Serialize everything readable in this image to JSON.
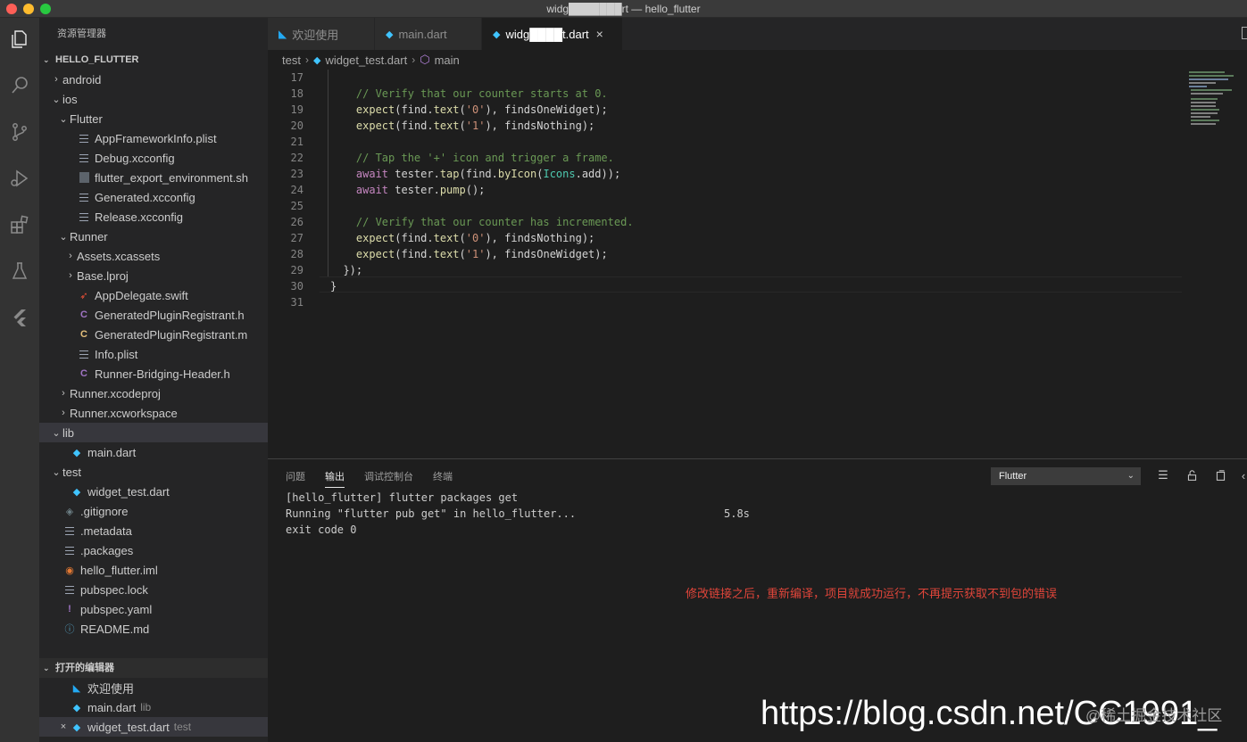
{
  "window": {
    "title": "widg███████rt — hello_flutter"
  },
  "activity_bar": {
    "items": [
      "explorer-icon",
      "search-icon",
      "source-control-icon",
      "run-debug-icon",
      "extensions-icon",
      "testing-icon",
      "flutter-icon"
    ]
  },
  "sidebar": {
    "title": "资源管理器",
    "project_section": "HELLO_FLUTTER",
    "tree": [
      {
        "label": "android",
        "indent": 1,
        "twist": "›",
        "icon": "none"
      },
      {
        "label": "ios",
        "indent": 1,
        "twist": "⌄",
        "icon": "none"
      },
      {
        "label": "Flutter",
        "indent": 2,
        "twist": "⌄",
        "icon": "none"
      },
      {
        "label": "AppFrameworkInfo.plist",
        "indent": 3,
        "twist": "",
        "icon": "lines"
      },
      {
        "label": "Debug.xcconfig",
        "indent": 3,
        "twist": "",
        "icon": "lines"
      },
      {
        "label": "flutter_export_environment.sh",
        "indent": 3,
        "twist": "",
        "icon": "sh"
      },
      {
        "label": "Generated.xcconfig",
        "indent": 3,
        "twist": "",
        "icon": "lines"
      },
      {
        "label": "Release.xcconfig",
        "indent": 3,
        "twist": "",
        "icon": "lines"
      },
      {
        "label": "Runner",
        "indent": 2,
        "twist": "⌄",
        "icon": "none"
      },
      {
        "label": "Assets.xcassets",
        "indent": 3,
        "twist": "›",
        "icon": "none"
      },
      {
        "label": "Base.lproj",
        "indent": 3,
        "twist": "›",
        "icon": "none"
      },
      {
        "label": "AppDelegate.swift",
        "indent": 3,
        "twist": "",
        "icon": "swift"
      },
      {
        "label": "GeneratedPluginRegistrant.h",
        "indent": 3,
        "twist": "",
        "icon": "c"
      },
      {
        "label": "GeneratedPluginRegistrant.m",
        "indent": 3,
        "twist": "",
        "icon": "c-yellow"
      },
      {
        "label": "Info.plist",
        "indent": 3,
        "twist": "",
        "icon": "lines"
      },
      {
        "label": "Runner-Bridging-Header.h",
        "indent": 3,
        "twist": "",
        "icon": "c"
      },
      {
        "label": "Runner.xcodeproj",
        "indent": 2,
        "twist": "›",
        "icon": "none"
      },
      {
        "label": "Runner.xcworkspace",
        "indent": 2,
        "twist": "›",
        "icon": "none"
      },
      {
        "label": "lib",
        "indent": 1,
        "twist": "⌄",
        "icon": "none",
        "selected": true
      },
      {
        "label": "main.dart",
        "indent": 2,
        "twist": "",
        "icon": "dart"
      },
      {
        "label": "test",
        "indent": 1,
        "twist": "⌄",
        "icon": "none"
      },
      {
        "label": "widget_test.dart",
        "indent": 2,
        "twist": "",
        "icon": "dart"
      },
      {
        "label": ".gitignore",
        "indent": 1,
        "twist": "",
        "icon": "git"
      },
      {
        "label": ".metadata",
        "indent": 1,
        "twist": "",
        "icon": "lines"
      },
      {
        "label": ".packages",
        "indent": 1,
        "twist": "",
        "icon": "lines"
      },
      {
        "label": "hello_flutter.iml",
        "indent": 1,
        "twist": "",
        "icon": "rss"
      },
      {
        "label": "pubspec.lock",
        "indent": 1,
        "twist": "",
        "icon": "lines"
      },
      {
        "label": "pubspec.yaml",
        "indent": 1,
        "twist": "",
        "icon": "excl"
      },
      {
        "label": "README.md",
        "indent": 1,
        "twist": "",
        "icon": "info"
      }
    ],
    "open_editors_section": "打开的编辑器",
    "open_editors": [
      {
        "label": "欢迎使用",
        "desc": "",
        "icon": "vscode"
      },
      {
        "label": "main.dart",
        "desc": "lib",
        "icon": "dart"
      },
      {
        "label": "widget_test.dart",
        "desc": "test",
        "icon": "dart",
        "active": true
      }
    ]
  },
  "tabs": [
    {
      "label": "欢迎使用",
      "icon": "vscode"
    },
    {
      "label": "main.dart",
      "icon": "dart"
    },
    {
      "label": "widg████t.dart",
      "icon": "dart",
      "active": true,
      "close": "×"
    }
  ],
  "breadcrumb": [
    "test",
    "widget_test.dart",
    "main"
  ],
  "editor": {
    "lines": [
      {
        "n": "17",
        "code": ""
      },
      {
        "n": "18",
        "code": "    // Verify that our counter starts at 0."
      },
      {
        "n": "19",
        "code": "    expect(find.text('0'), findsOneWidget);"
      },
      {
        "n": "20",
        "code": "    expect(find.text('1'), findsNothing);"
      },
      {
        "n": "21",
        "code": ""
      },
      {
        "n": "22",
        "code": "    // Tap the '+' icon and trigger a frame."
      },
      {
        "n": "23",
        "code": "    await tester.tap(find.byIcon(Icons.add));"
      },
      {
        "n": "24",
        "code": "    await tester.pump();"
      },
      {
        "n": "25",
        "code": ""
      },
      {
        "n": "26",
        "code": "    // Verify that our counter has incremented."
      },
      {
        "n": "27",
        "code": "    expect(find.text('0'), findsNothing);"
      },
      {
        "n": "28",
        "code": "    expect(find.text('1'), findsOneWidget);"
      },
      {
        "n": "29",
        "code": "  });"
      },
      {
        "n": "30",
        "code": "}"
      },
      {
        "n": "31",
        "code": ""
      }
    ]
  },
  "panel": {
    "tabs": [
      "问题",
      "输出",
      "调试控制台",
      "终端"
    ],
    "active_tab": "输出",
    "channel": "Flutter",
    "output": [
      {
        "text": "[hello_flutter] flutter packages get",
        "time": ""
      },
      {
        "text": "Running \"flutter pub get\" in hello_flutter...",
        "time": "5.8s"
      },
      {
        "text": "exit code 0",
        "time": ""
      }
    ],
    "annotation": "修改链接之后，重新编译，项目就成功运行，不再提示获取不到包的错误"
  },
  "watermark": {
    "text": "https://blog.csdn.net/CC1991_",
    "sub": "@稀土掘金技术社区"
  },
  "colors": {
    "accent": "#007acc",
    "annotation": "#e0453a",
    "dart": "#40c4ff"
  }
}
